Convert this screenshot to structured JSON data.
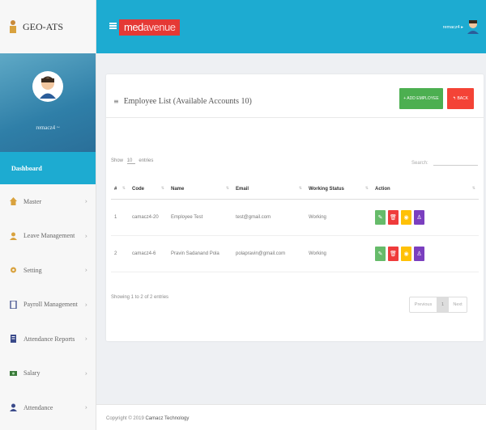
{
  "brand": {
    "title": "GEO-ATS"
  },
  "profile": {
    "name": "remacz4 ~"
  },
  "sidebar": {
    "items": [
      {
        "label": "Dashboard",
        "icon": "dashboard",
        "active": true
      },
      {
        "label": "Master",
        "icon": "home-icon"
      },
      {
        "label": "Leave Management",
        "icon": "user-icon"
      },
      {
        "label": "Setting",
        "icon": "gear-icon"
      },
      {
        "label": "Payroll Management",
        "icon": "document-icon"
      },
      {
        "label": "Attendance Reports",
        "icon": "document-icon"
      },
      {
        "label": "Salary",
        "icon": "money-icon"
      },
      {
        "label": "Attendance",
        "icon": "user-icon"
      }
    ]
  },
  "topbar": {
    "logo_main": "med",
    "logo_rest": "avenue",
    "user_label": "remacz4 ▸"
  },
  "card": {
    "menu_icon": "≡",
    "title": "Employee List (Available Accounts 10)",
    "add_button": "+ ADD EMPLOYEE",
    "back_button": "↰ BACK"
  },
  "table_controls": {
    "show_prefix": "Show",
    "show_value": "10",
    "show_suffix": "entries",
    "search_label": "Search:"
  },
  "table": {
    "headers": [
      "#",
      "Code",
      "Name",
      "Email",
      "Working Status",
      "Action"
    ],
    "rows": [
      {
        "num": "1",
        "code": "camacz4-20",
        "name": "Employee Test",
        "email": "test@gmail.com",
        "status": "Working"
      },
      {
        "num": "2",
        "code": "camacz4-6",
        "name": "Pravin Sadanand Pola",
        "email": "polapravin@gmail.com",
        "status": "Working"
      }
    ]
  },
  "info": {
    "text": "Showing 1 to 2 of 2 entries"
  },
  "pagination": {
    "prev": "Previous",
    "page": "1",
    "next": "Next"
  },
  "footer": {
    "prefix": "Copyright © 2019",
    "company": "Camacz Technology"
  },
  "colors": {
    "primary": "#1dabd1",
    "add": "#4caf50",
    "back": "#f44336",
    "logo": "#e53935"
  }
}
